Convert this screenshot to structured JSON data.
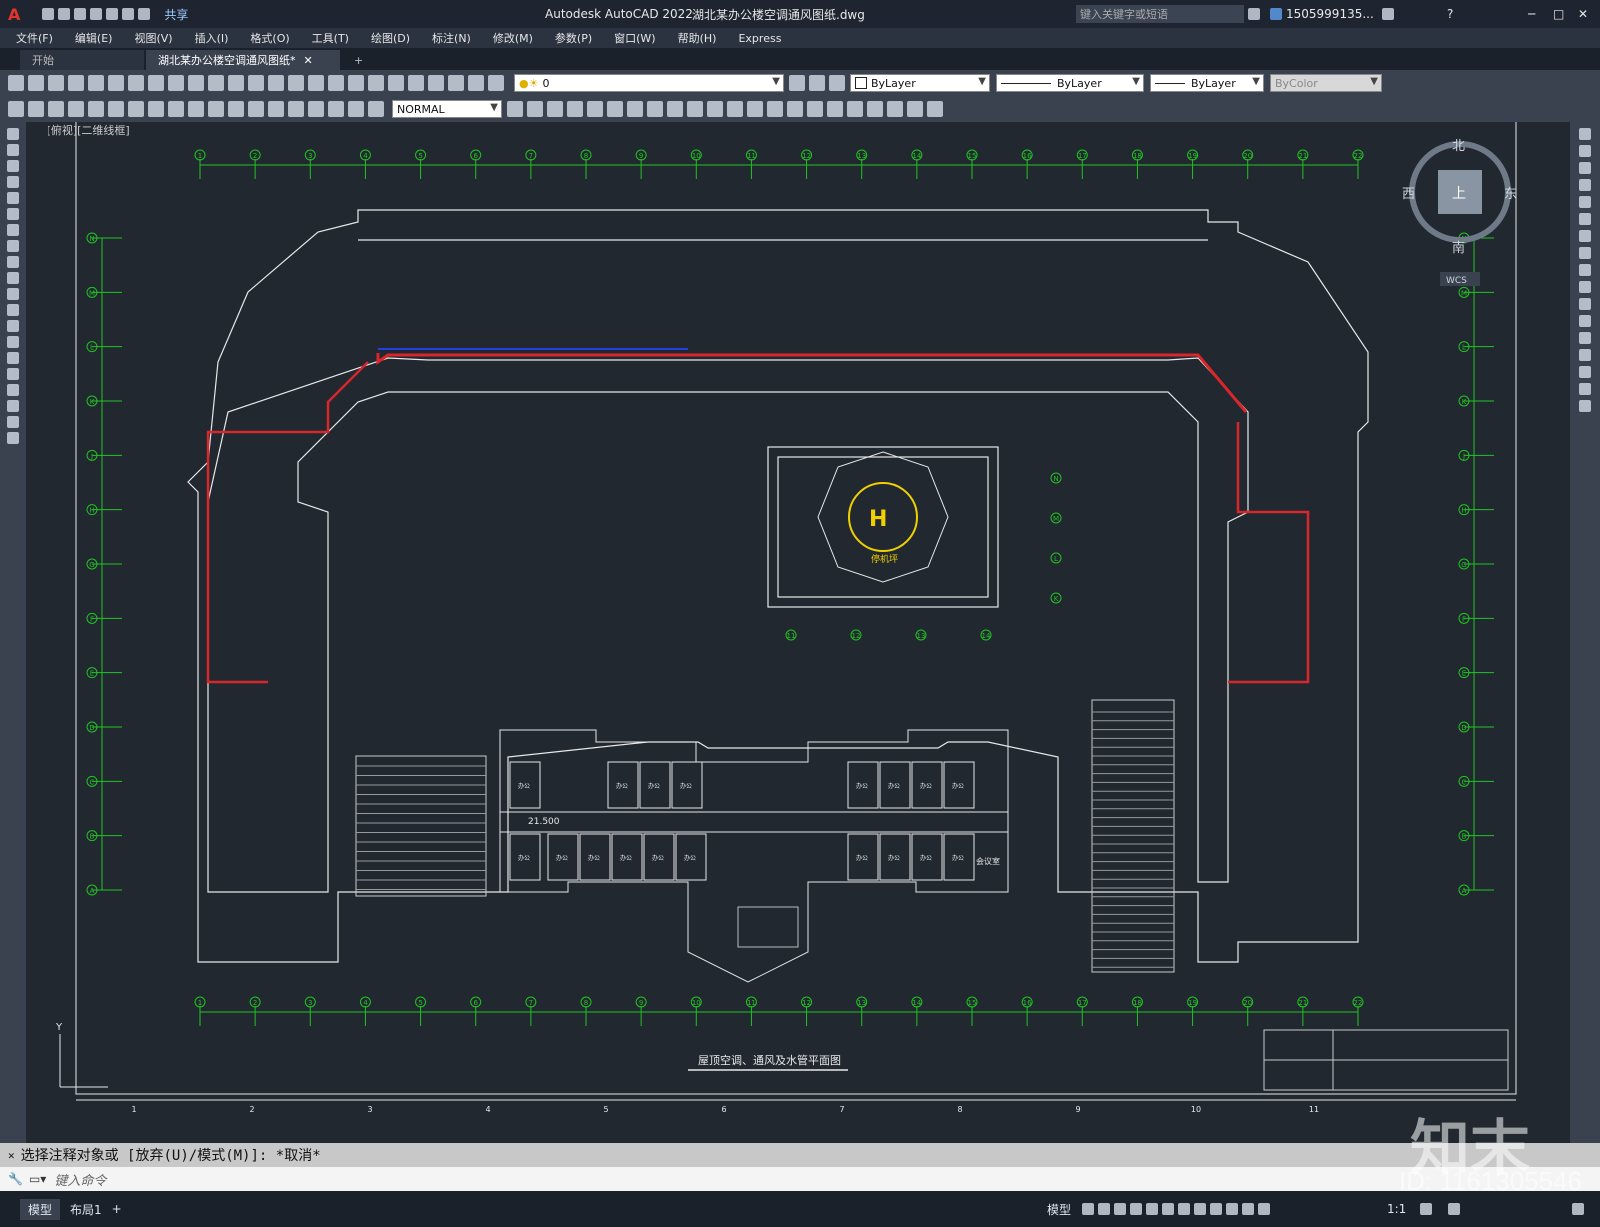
{
  "titlebar": {
    "app_logo": "A",
    "share": "共享",
    "title": "Autodesk AutoCAD 2022",
    "filename": "湖北某办公楼空调通风图纸.dwg",
    "search_placeholder": "键入关键字或短语",
    "user": "1505999135...",
    "help": "?"
  },
  "menu": [
    "文件(F)",
    "编辑(E)",
    "视图(V)",
    "插入(I)",
    "格式(O)",
    "工具(T)",
    "绘图(D)",
    "标注(N)",
    "修改(M)",
    "参数(P)",
    "窗口(W)",
    "帮助(H)",
    "Express"
  ],
  "tabs": [
    {
      "label": "开始"
    },
    {
      "label": "湖北某办公楼空调通风图纸*"
    }
  ],
  "toolbar": {
    "layer_value": "0",
    "color_value": "ByLayer",
    "linetype_value": "ByLayer",
    "lineweight_value": "ByLayer",
    "plotstyle_value": "ByColor",
    "text_style": "NORMAL"
  },
  "viewport_label": "[-][俯视][二维线框]",
  "viewcube": {
    "north": "北",
    "south": "南",
    "east": "东",
    "west": "西",
    "top": "上",
    "ucs": "WCS"
  },
  "drawing": {
    "grid_top": [
      "1",
      "2",
      "3",
      "4",
      "5",
      "6",
      "7",
      "8",
      "9",
      "10",
      "11",
      "12",
      "13",
      "14",
      "15",
      "16",
      "17",
      "18",
      "19",
      "20",
      "21",
      "22"
    ],
    "grid_side": [
      "N",
      "M",
      "L",
      "K",
      "J",
      "H",
      "G",
      "F",
      "E",
      "D",
      "C",
      "B",
      "A"
    ],
    "title_text": "屋顶空调、通风及水管平面图",
    "heliport_label": "停机坪",
    "heli_grid": [
      "11",
      "12",
      "13",
      "14"
    ],
    "heli_side": [
      "N",
      "M",
      "L",
      "K"
    ],
    "bottom_ruler": [
      "1",
      "2",
      "3",
      "4",
      "5",
      "6",
      "7",
      "8",
      "9",
      "10",
      "11"
    ],
    "elevation_label": "21.500",
    "room_label_office": "办公",
    "room_label_meeting": "会议室"
  },
  "command": {
    "history": "选择注释对象或 [放弃(U)/模式(M)]: *取消*",
    "placeholder": "键入命令"
  },
  "status": {
    "tab_model": "模型",
    "tab_layout": "布局1",
    "model": "模型",
    "scale": "1:1"
  },
  "watermark": {
    "logo": "知末",
    "id": "ID: 1161305546"
  }
}
